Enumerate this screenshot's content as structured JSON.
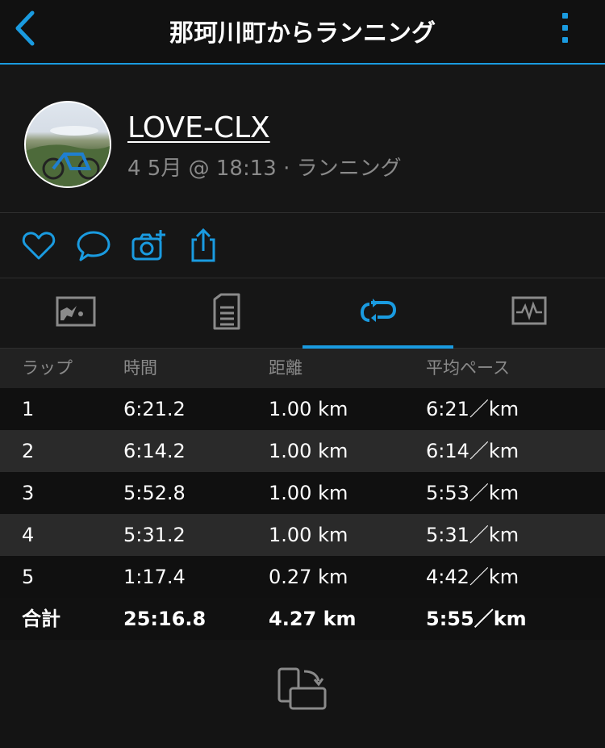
{
  "header": {
    "title": "那珂川町からランニング",
    "back_icon": "chevron-left-icon",
    "menu_icon": "kebab-menu-icon"
  },
  "profile": {
    "username": "LOVE-CLX",
    "meta": "4 5月 @ 18:13 · ランニング"
  },
  "actions": [
    "heart-icon",
    "comment-icon",
    "add-photo-icon",
    "share-icon"
  ],
  "tabs": [
    {
      "icon": "map-icon",
      "active": false
    },
    {
      "icon": "document-list-icon",
      "active": false
    },
    {
      "icon": "laps-icon",
      "active": true
    },
    {
      "icon": "chart-icon",
      "active": false
    }
  ],
  "laps": {
    "headers": {
      "lap": "ラップ",
      "time": "時間",
      "distance": "距離",
      "pace": "平均ペース"
    },
    "rows": [
      {
        "lap": "1",
        "time": "6:21.2",
        "distance": "1.00 km",
        "pace": "6:21／km"
      },
      {
        "lap": "2",
        "time": "6:14.2",
        "distance": "1.00 km",
        "pace": "6:14／km"
      },
      {
        "lap": "3",
        "time": "5:52.8",
        "distance": "1.00 km",
        "pace": "5:53／km"
      },
      {
        "lap": "4",
        "time": "5:31.2",
        "distance": "1.00 km",
        "pace": "5:31／km"
      },
      {
        "lap": "5",
        "time": "1:17.4",
        "distance": "0.27 km",
        "pace": "4:42／km"
      }
    ],
    "total": {
      "lap": "合計",
      "time": "25:16.8",
      "distance": "4.27 km",
      "pace": "5:55／km"
    }
  },
  "footer": {
    "rotate_icon": "rotate-screen-icon"
  },
  "colors": {
    "accent": "#1a9be0",
    "background": "#141414",
    "muted_text": "#8a8a8a"
  }
}
